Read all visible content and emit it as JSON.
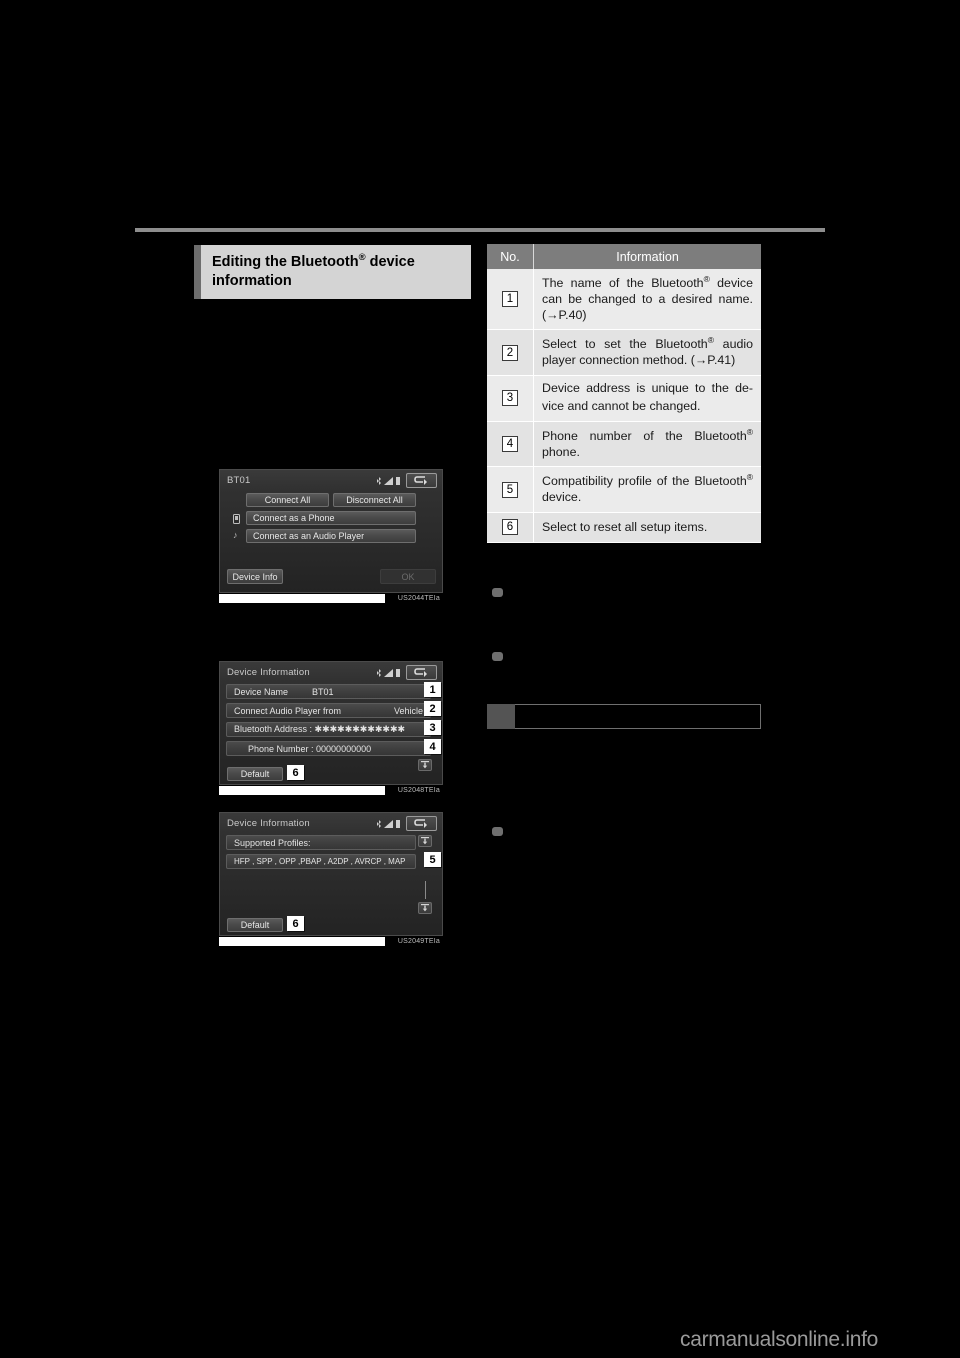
{
  "page": {
    "watermark": "carmanualsonline.info"
  },
  "left": {
    "section_heading": {
      "line1_pre": "Editing the Bluetooth",
      "reg": "®",
      "line1_post": " device",
      "line2": "information"
    },
    "screens": [
      {
        "id": "screen-bt01",
        "title": "BT01",
        "caption": "US2044TEIa",
        "buttons": {
          "connect_all": "Connect All",
          "disconnect_all": "Disconnect All",
          "connect_as_phone": "Connect as a Phone",
          "connect_as_audio": "Connect as an Audio Player",
          "device_info": "Device Info",
          "ok": "OK"
        },
        "icons": {
          "phone": "▁",
          "music": "♪"
        }
      },
      {
        "id": "screen-device-information-1",
        "title": "Device Information",
        "caption": "US2048TEIa",
        "fields": [
          {
            "label": "Device Name",
            "value": "BT01",
            "badge": "1"
          },
          {
            "label": "Connect Audio Player from",
            "value": "Vehicle",
            "badge": "2"
          },
          {
            "label": "Bluetooth Address : ✱✱✱✱✱✱✱✱✱✱✱✱",
            "value": "",
            "badge": "3"
          },
          {
            "label": "Phone Number : 00000000000",
            "value": "",
            "badge": "4"
          }
        ],
        "default_button": "Default",
        "default_badge": "6"
      },
      {
        "id": "screen-device-information-2",
        "title": "Device Information",
        "caption": "US2049TEIa",
        "profiles_label": "Supported Profiles:",
        "profiles_value": "HFP  ,  SPP  ,  OPP  ,PBAP ,  A2DP  , AVRCP ,  MAP",
        "profiles_badge": "5",
        "default_button": "Default",
        "default_badge": "6"
      }
    ]
  },
  "right": {
    "table": {
      "headers": [
        "No.",
        "Information"
      ],
      "rows": [
        {
          "no": "1",
          "text_pre": "The name of the Bluetooth",
          "reg": "®",
          "text_post": " device can be changed to a desired name. (→P.40)"
        },
        {
          "no": "2",
          "text_pre": "Select to set the Bluetooth",
          "reg": "®",
          "text_post": " audio player connection method. (→P.41)"
        },
        {
          "no": "3",
          "text_pre": "Device address is unique to the de-vice and cannot be changed.",
          "reg": "",
          "text_post": ""
        },
        {
          "no": "4",
          "text_pre": "Phone number of the Bluetooth",
          "reg": "®",
          "text_post": " phone."
        },
        {
          "no": "5",
          "text_pre": "Compatibility profile of the Bluetooth",
          "reg": "®",
          "text_post": " device."
        },
        {
          "no": "6",
          "text_pre": "Select to reset all setup items.",
          "reg": "",
          "text_post": ""
        }
      ]
    }
  }
}
